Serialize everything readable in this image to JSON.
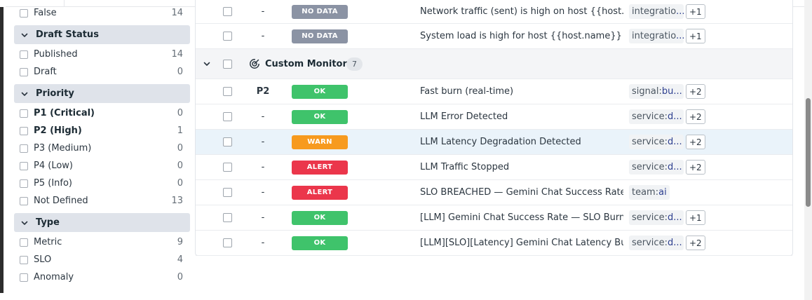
{
  "sidebar": {
    "partial_row": {
      "label": "False",
      "count": "14"
    },
    "facets": [
      {
        "title": "Draft Status",
        "items": [
          {
            "label": "Published",
            "count": "14",
            "bold": false
          },
          {
            "label": "Draft",
            "count": "0",
            "bold": false
          }
        ]
      },
      {
        "title": "Priority",
        "items": [
          {
            "label": "P1 (Critical)",
            "count": "0",
            "bold": true
          },
          {
            "label": "P2 (High)",
            "count": "1",
            "bold": true
          },
          {
            "label": "P3 (Medium)",
            "count": "0",
            "bold": false
          },
          {
            "label": "P4 (Low)",
            "count": "0",
            "bold": false
          },
          {
            "label": "P5 (Info)",
            "count": "0",
            "bold": false
          },
          {
            "label": "Not Defined",
            "count": "13",
            "bold": false
          }
        ]
      },
      {
        "title": "Type",
        "items": [
          {
            "label": "Metric",
            "count": "9",
            "bold": false
          },
          {
            "label": "SLO",
            "count": "4",
            "bold": false
          },
          {
            "label": "Anomaly",
            "count": "0",
            "bold": false
          }
        ]
      }
    ]
  },
  "table": {
    "top_rows": [
      {
        "priority": "-",
        "status": "NO DATA",
        "status_color": "#8b93a4",
        "name": "Network traffic (sent) is high on host {{host.name",
        "tag_key": "integratio",
        "tag_value": "...",
        "more": "+1"
      },
      {
        "priority": "-",
        "status": "NO DATA",
        "status_color": "#8b93a4",
        "name": "System load is high for host {{host.name}}",
        "tag_key": "integratio",
        "tag_value": "...",
        "more": "+1"
      }
    ],
    "group": {
      "title": "Custom Monitors",
      "count": "7"
    },
    "group_rows": [
      {
        "priority": "P2",
        "priority_bold": true,
        "status": "OK",
        "status_color": "#3fc36b",
        "name": "Fast burn (real-time)",
        "tag_key": "signal:",
        "tag_value": "bu...",
        "more": "+2",
        "highlight": false
      },
      {
        "priority": "-",
        "priority_bold": false,
        "status": "OK",
        "status_color": "#3fc36b",
        "name": "LLM Error Detected",
        "tag_key": "service:",
        "tag_value": "d...",
        "more": "+2",
        "highlight": false
      },
      {
        "priority": "-",
        "priority_bold": false,
        "status": "WARN",
        "status_color": "#f79a1e",
        "name": "LLM Latency Degradation Detected",
        "tag_key": "service:",
        "tag_value": "d...",
        "more": "+2",
        "highlight": true
      },
      {
        "priority": "-",
        "priority_bold": false,
        "status": "ALERT",
        "status_color": "#eb364b",
        "name": "LLM Traffic Stopped",
        "tag_key": "service:",
        "tag_value": "d...",
        "more": "+2",
        "highlight": false
      },
      {
        "priority": "-",
        "priority_bold": false,
        "status": "ALERT",
        "status_color": "#eb364b",
        "name": "SLO BREACHED — Gemini Chat Success Rate",
        "tag_key": "team:",
        "tag_value": "ai",
        "more": "",
        "highlight": false
      },
      {
        "priority": "-",
        "priority_bold": false,
        "status": "OK",
        "status_color": "#3fc36b",
        "name": "[LLM] Gemini Chat Success Rate — SLO Burn Ra",
        "tag_key": "service:",
        "tag_value": "d...",
        "more": "+1",
        "highlight": false
      },
      {
        "priority": "-",
        "priority_bold": false,
        "status": "OK",
        "status_color": "#3fc36b",
        "name": "[LLM][SLO][Latency] Gemini Chat Latency Budge",
        "tag_key": "service:",
        "tag_value": "d...",
        "more": "+2",
        "highlight": false
      }
    ]
  },
  "icons": {
    "chevron": "chevron-down-icon",
    "group": "monitor-group-icon"
  }
}
